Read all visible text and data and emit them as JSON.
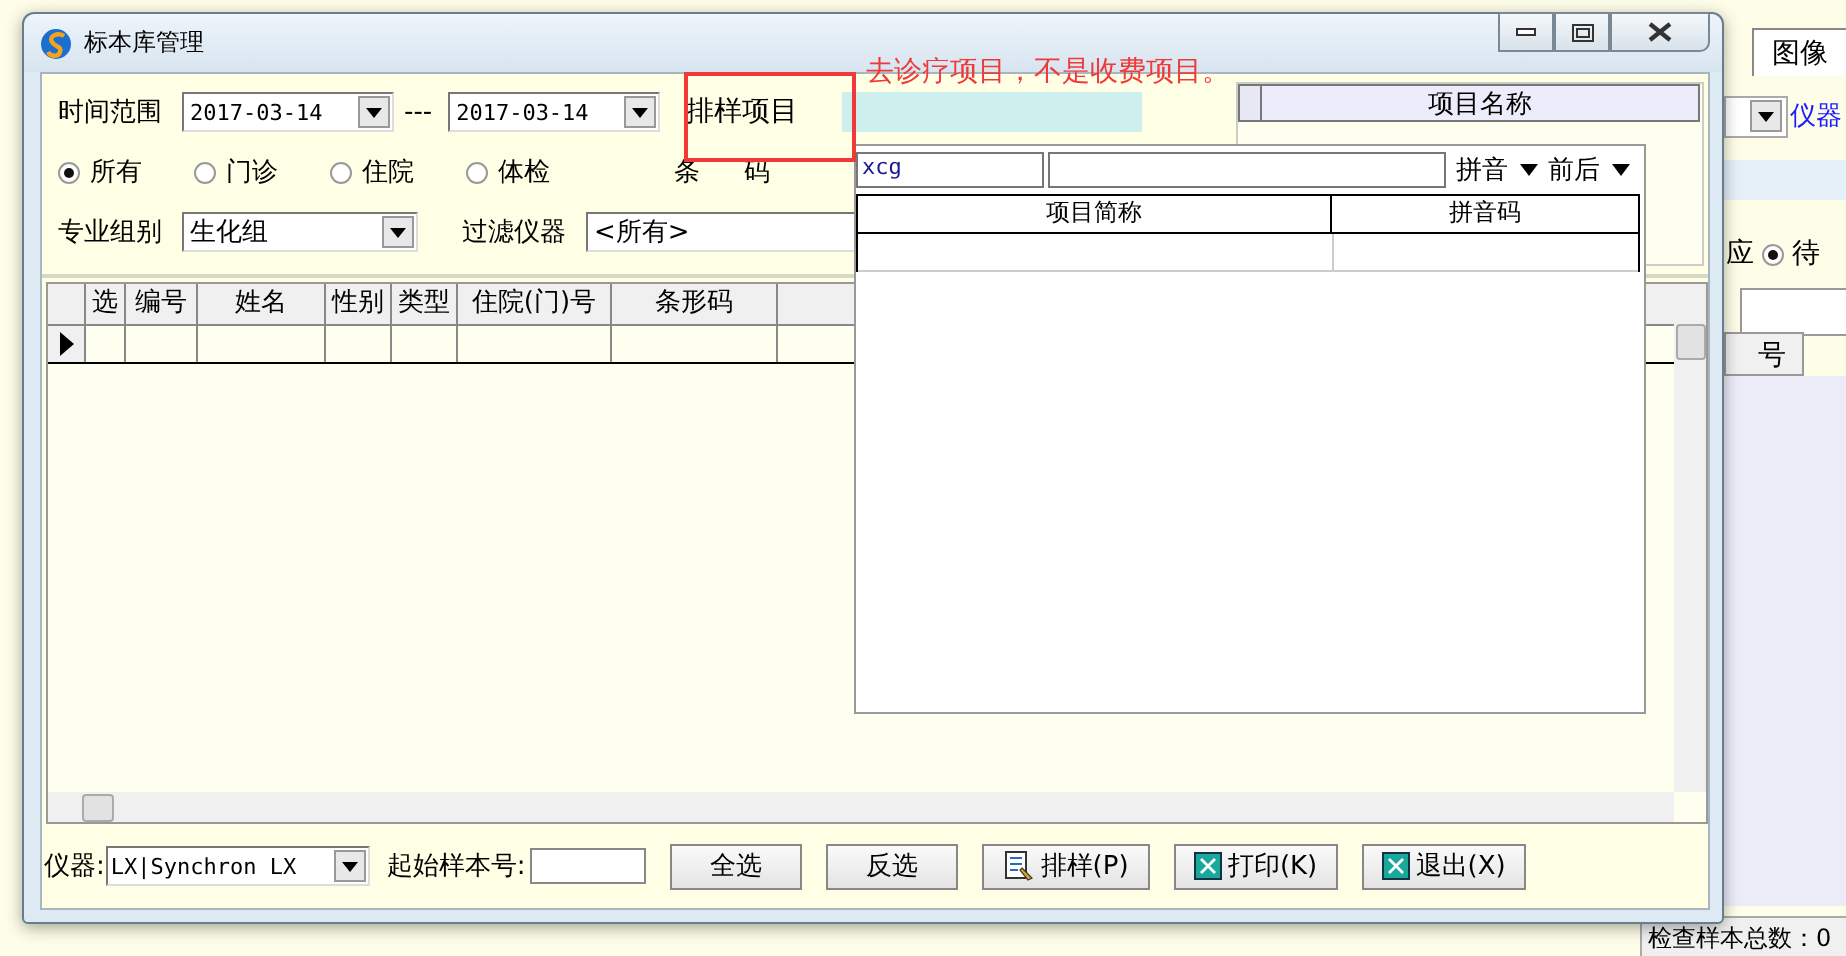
{
  "background_app": {
    "tab": "图像",
    "instrument_link": "仪器",
    "text_fragment": "应",
    "radio": {
      "label": "待",
      "selected": true
    },
    "column_fragment": "号",
    "status_bar": "检查样本总数：0"
  },
  "window": {
    "title": "标本库管理"
  },
  "filters": {
    "date_label": "时间范围",
    "date_from": "2017-03-14",
    "separator": "---",
    "date_to": "2017-03-14",
    "scheduling_label": "排样项目",
    "barcode_label": "条 码",
    "visit_types": [
      {
        "label": "所有",
        "selected": true
      },
      {
        "label": "门诊",
        "selected": false
      },
      {
        "label": "住院",
        "selected": false
      },
      {
        "label": "体检",
        "selected": false
      }
    ],
    "group_label": "专业组别",
    "group": "生化组",
    "instrument_filter_label": "过滤仪器",
    "instrument_filter": "<所有>"
  },
  "annotation": "去诊疗项目，不是收费项目。",
  "grid": {
    "columns": [
      "选",
      "编号",
      "姓名",
      "性别",
      "类型",
      "住院(门)号",
      "条形码"
    ]
  },
  "items_panel": {
    "columns": [
      "项目名称"
    ]
  },
  "lookup_popup": {
    "query": "xcg",
    "mode": "拼音",
    "match": "前后",
    "columns": [
      "项目简称",
      "拼音码"
    ]
  },
  "footer": {
    "instrument_label": "仪器:",
    "instrument": "LX|Synchron LX",
    "start_label": "起始样本号:",
    "buttons": [
      {
        "label": "全选",
        "kind": "plain"
      },
      {
        "label": "反选",
        "kind": "plain"
      },
      {
        "label": "排样(P)",
        "kind": "sort"
      },
      {
        "label": "打印(K)",
        "kind": "box"
      },
      {
        "label": "退出(X)",
        "kind": "box"
      }
    ]
  }
}
